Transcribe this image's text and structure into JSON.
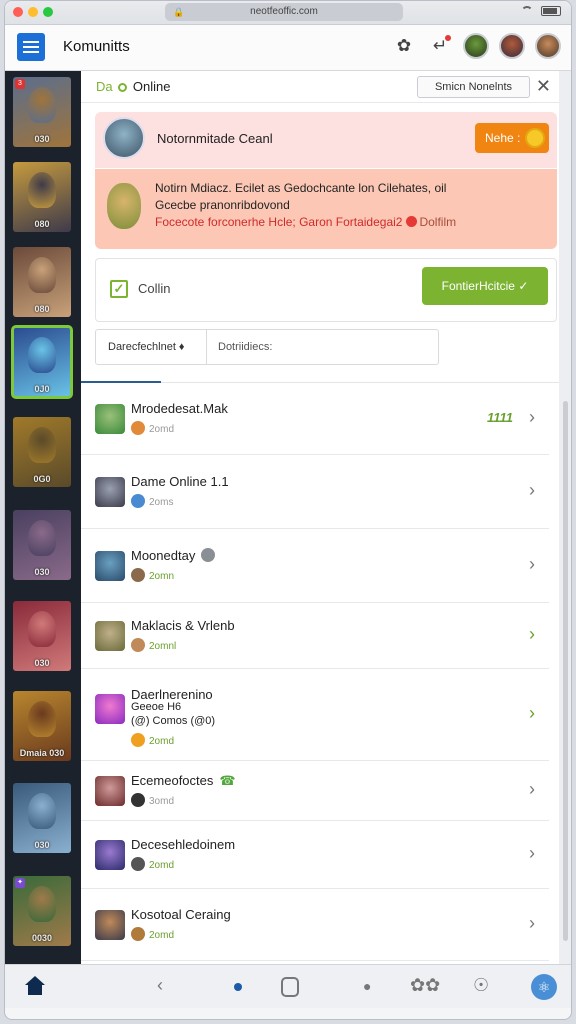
{
  "os": {
    "url": "neotfeoffic.com"
  },
  "header": {
    "title": "Komunitts"
  },
  "panel": {
    "online_prefix": "Da",
    "online_label": "Online",
    "sort_button": "Smicn Nonelnts",
    "alert1": {
      "title": "Notornmitade Ceanl",
      "button": "Nehe :"
    },
    "alert2": {
      "line1": "Notirn Mdiacz. Ecilet  as Gedochcante lon Cilehates, oil",
      "line2": "Gcecbe pranonribdovond",
      "line3": "Focecote forconerhe Hcle; Garon Fortaidegai2",
      "line3_suffix": "Dolfilm"
    },
    "check": {
      "label": "Collin",
      "button": "FontierHcitcie ✓"
    },
    "filters": {
      "a": "Darecfechlnet ♦",
      "b": "Dotriidiecs:"
    }
  },
  "rows": [
    {
      "name": "Mrodedesat.Mak",
      "sub": "2omd",
      "score": "1111",
      "chevron": "›"
    },
    {
      "name": "Dame Online 1.1",
      "sub": "2oms",
      "chevron": "›"
    },
    {
      "name": "Moonedtay",
      "sub": "2omn",
      "chevron": "›"
    },
    {
      "name": "Maklacis & Vrlenb",
      "sub": "2omnl",
      "chevron": "›"
    },
    {
      "name": "Daerlnerenino",
      "name2": "Geeoe  H6",
      "name3": "(@) Comos (@0)",
      "sub": "2omd",
      "chevron": "›"
    },
    {
      "name": "Ecemeofoctes",
      "sub": "3omd",
      "chevron": "›"
    },
    {
      "name": "Decesehledoinem",
      "sub": "2omd",
      "chevron": "›"
    },
    {
      "name": "Kosotoal Ceraing",
      "sub": "2omd",
      "chevron": "›"
    }
  ],
  "strip": [
    {
      "lvl": "030",
      "badge": "3",
      "color1": "#5a6e8e",
      "color2": "#a0743a"
    },
    {
      "lvl": "080",
      "color1": "#c59a3e",
      "color2": "#3e3a4a"
    },
    {
      "lvl": "080",
      "color1": "#6b4a3a",
      "color2": "#c9a27a"
    },
    {
      "lvl": "0J0",
      "color1": "#2a4a8e",
      "color2": "#6ac4e8",
      "selected": true
    },
    {
      "lvl": "0G0",
      "color1": "#a07a2a",
      "color2": "#5a4a2a"
    },
    {
      "lvl": "030",
      "color1": "#4a4060",
      "color2": "#8a6a8a"
    },
    {
      "lvl": "030",
      "color1": "#8a2a3a",
      "color2": "#d07a7a"
    },
    {
      "lvl": "Dmaia 030",
      "color1": "#b8862e",
      "color2": "#6a3a1e"
    },
    {
      "lvl": "030",
      "color1": "#3a5a7a",
      "color2": "#8ab0d0"
    },
    {
      "lvl": "0030",
      "badge": "✦",
      "color1": "#3a6a3a",
      "color2": "#a07a4a"
    }
  ],
  "colors": {
    "accent": "#7cb432",
    "brand": "#1d6fd8",
    "alert": "#f08512"
  }
}
